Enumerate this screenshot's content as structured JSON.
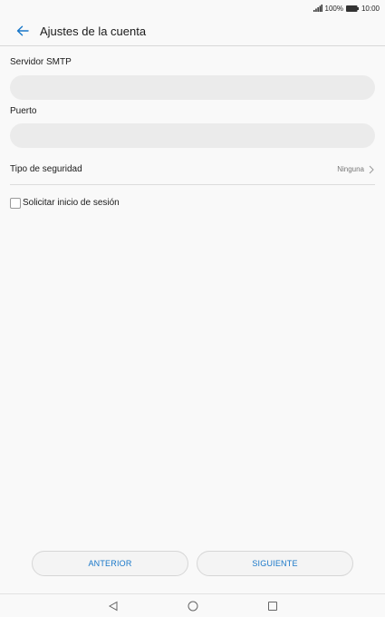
{
  "status_bar": {
    "battery": "100%",
    "time": "10:00",
    "icons": [
      "signal-icon",
      "battery-icon"
    ]
  },
  "app_bar": {
    "back_icon": "arrow-left-icon",
    "title": "Ajustes de la cuenta"
  },
  "form": {
    "smtp_server": {
      "label": "Servidor SMTP",
      "value": "",
      "placeholder": ""
    },
    "port": {
      "label": "Puerto",
      "value": "",
      "placeholder": ""
    },
    "security": {
      "label": "Tipo de seguridad",
      "value": "Ninguna",
      "icon": "chevron-right-icon"
    },
    "require_login": {
      "label": "Solicitar inicio de sesión",
      "checked": false
    }
  },
  "buttons": {
    "previous": "ANTERIOR",
    "next": "SIGUIENTE"
  },
  "nav_bar": {
    "icons": [
      "nav-back-icon",
      "nav-home-icon",
      "nav-recents-icon"
    ]
  },
  "colors": {
    "accent": "#1877c9",
    "background": "#f9f9f9",
    "field_background": "#ebebeb"
  }
}
